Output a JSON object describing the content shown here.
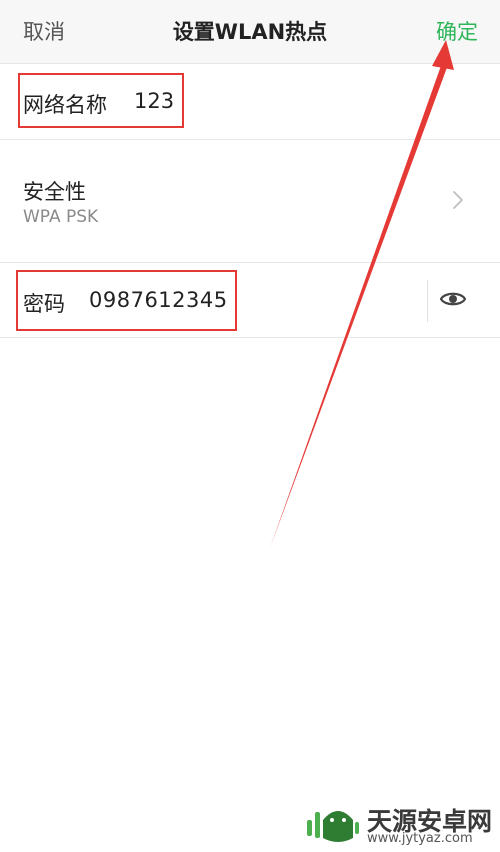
{
  "header": {
    "cancel_label": "取消",
    "title": "设置WLAN热点",
    "confirm_label": "确定"
  },
  "ssid_row": {
    "label": "网络名称",
    "value": "123"
  },
  "security_row": {
    "title": "安全性",
    "value": "WPA PSK",
    "chevron_icon": "chevron-right-icon"
  },
  "password_row": {
    "label": "密码",
    "value": "0987612345",
    "toggle_icon": "eye-icon"
  },
  "watermark": {
    "name": "天源安卓网",
    "url": "www.jytyaz.com"
  },
  "colors": {
    "accent_green": "#2fb55b",
    "annotation_red": "#e53935"
  }
}
